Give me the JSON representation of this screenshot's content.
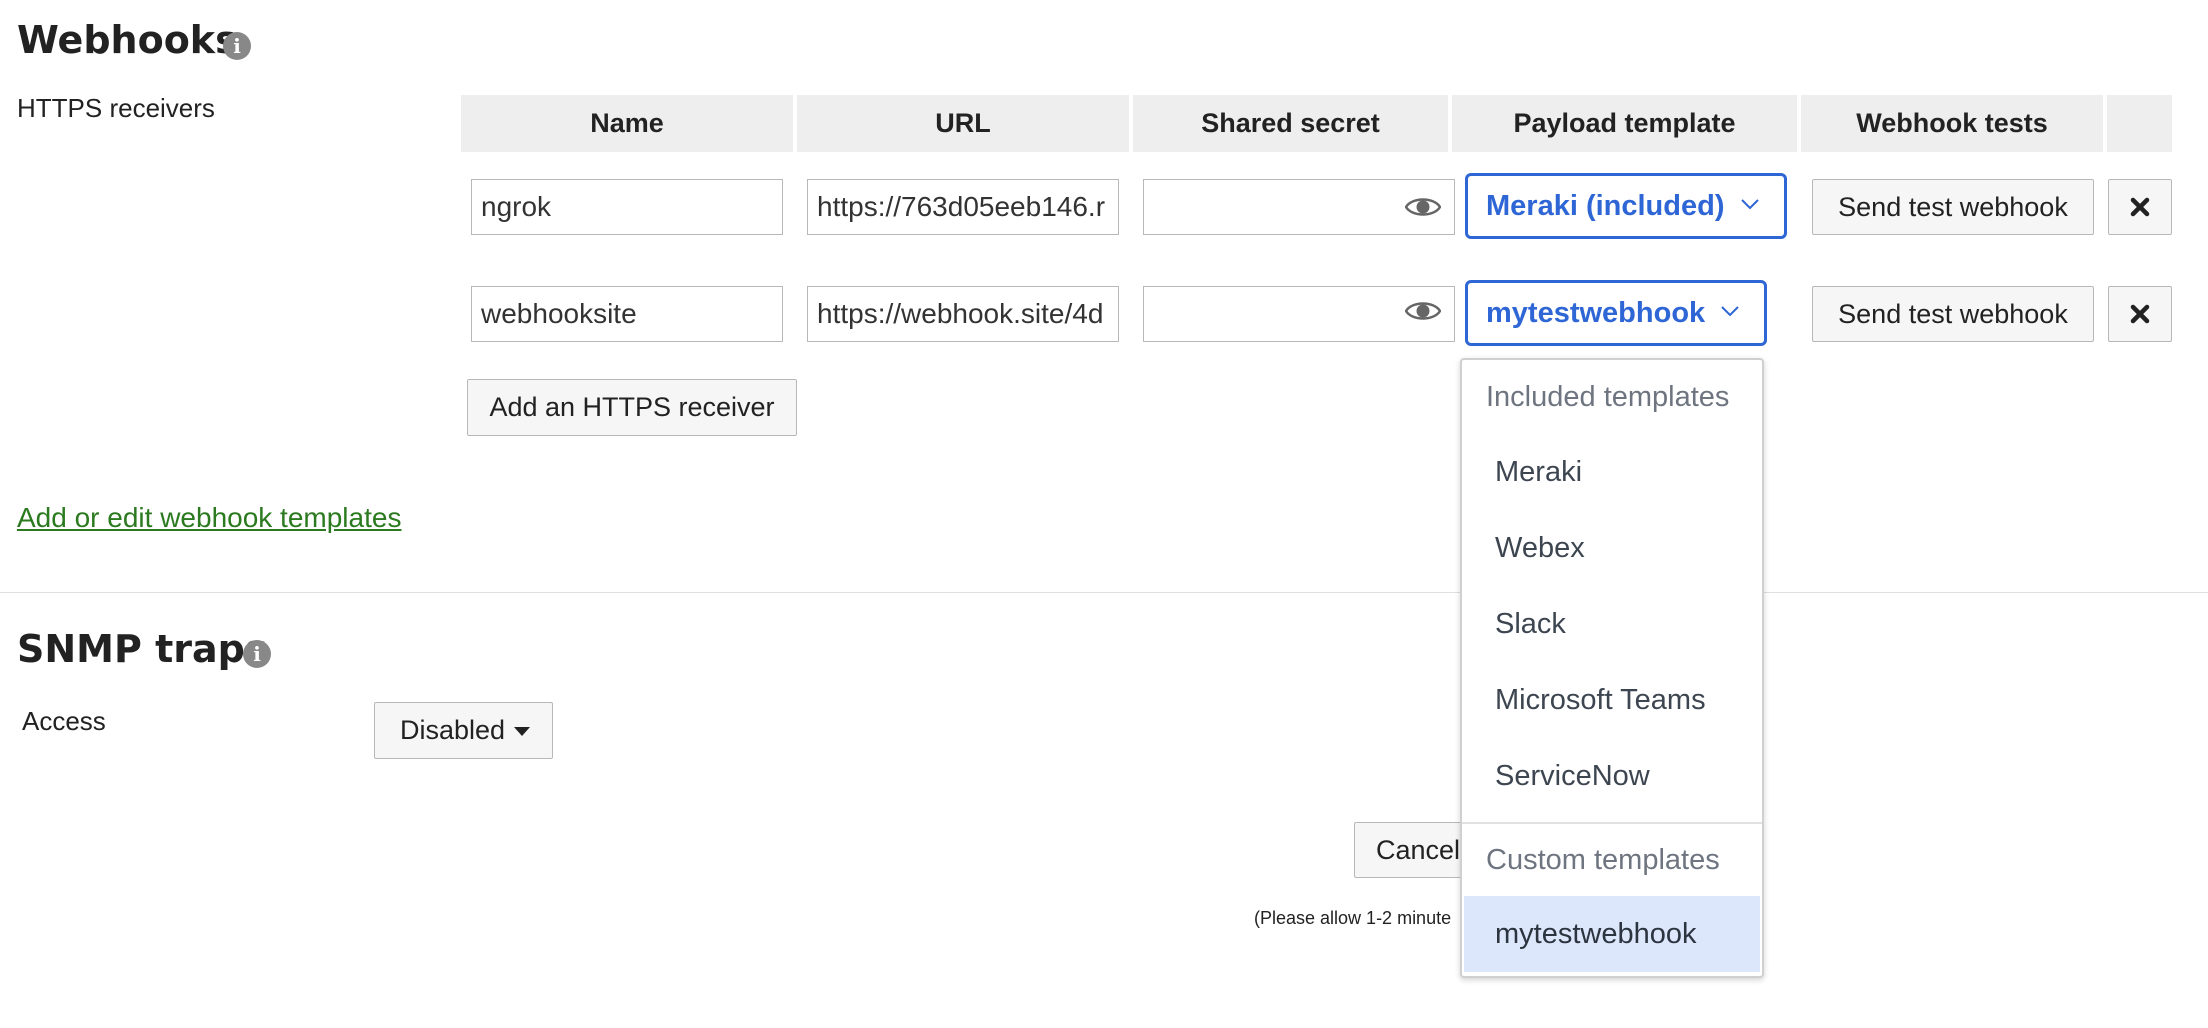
{
  "webhooks": {
    "title": "Webhooks",
    "receivers_label": "HTTPS receivers",
    "columns": [
      "Name",
      "URL",
      "Shared secret",
      "Payload template",
      "Webhook tests",
      ""
    ],
    "rows": [
      {
        "name": "ngrok",
        "url": "https://763d05eeb146.r",
        "secret": "",
        "template": "Meraki (included)",
        "test_label": "Send test webhook"
      },
      {
        "name": "webhooksite",
        "url": "https://webhook.site/4d",
        "secret": "",
        "template": "mytestwebhook",
        "test_label": "Send test webhook"
      }
    ],
    "add_receiver_label": "Add an HTTPS receiver",
    "edit_templates_link": "Add or edit webhook templates"
  },
  "template_dropdown": {
    "included_header": "Included templates",
    "included": [
      "Meraki",
      "Webex",
      "Slack",
      "Microsoft Teams",
      "ServiceNow"
    ],
    "custom_header": "Custom templates",
    "custom": [
      "mytestwebhook"
    ],
    "selected": "mytestwebhook"
  },
  "snmp": {
    "title": "SNMP traps",
    "access_label": "Access",
    "access_value": "Disabled"
  },
  "footer": {
    "cancel_label": "Cancel",
    "note": "(Please allow 1-2 minute"
  },
  "icons": {
    "info": "info-icon",
    "eye": "eye-icon",
    "chevron": "chevron-down-icon",
    "caret": "caret-down-icon",
    "delete": "close-icon"
  },
  "colors": {
    "accent": "#2f66d5",
    "link": "#2b7a1f",
    "selected_bg": "#dde7fb",
    "header_bg": "#eeeeee"
  }
}
